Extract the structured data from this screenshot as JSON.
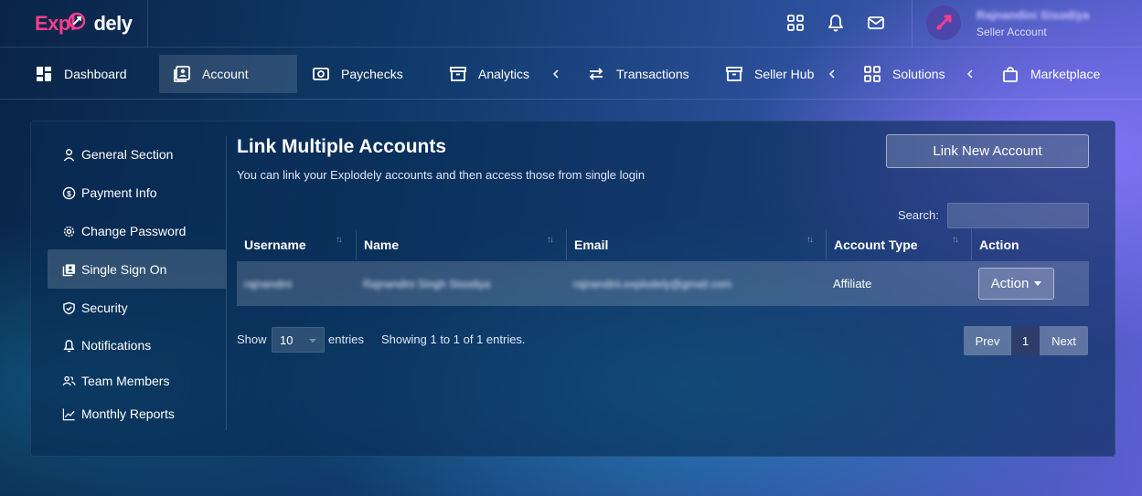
{
  "app": {
    "logo_prefix": "Expl",
    "logo_suffix": "dely",
    "logo_mark": "rocket-icon"
  },
  "header": {
    "icons": [
      "apps-grid-icon",
      "bell-icon",
      "mail-icon"
    ],
    "user": {
      "name": "Rajnandini Sisodiya",
      "role": "Seller Account",
      "avatar_icon": "rocket-icon"
    }
  },
  "nav": {
    "items": [
      {
        "label": "Dashboard",
        "icon": "dashboard-icon",
        "active": false
      },
      {
        "label": "Account",
        "icon": "account-icon",
        "active": true
      },
      {
        "label": "Paychecks",
        "icon": "paycheck-icon",
        "active": false
      },
      {
        "label": "Analytics",
        "icon": "archive-icon",
        "active": false
      },
      {
        "label": "Transactions",
        "icon": "transfer-icon",
        "active": false
      },
      {
        "label": "Seller Hub",
        "icon": "archive-icon",
        "active": false
      },
      {
        "label": "Solutions",
        "icon": "grid-icon",
        "active": false
      },
      {
        "label": "Marketplace",
        "icon": "bag-icon",
        "active": false
      }
    ]
  },
  "sidebar": {
    "items": [
      {
        "label": "General Section",
        "icon": "user-icon"
      },
      {
        "label": "Payment Info",
        "icon": "dollar-icon"
      },
      {
        "label": "Change Password",
        "icon": "gear-icon"
      },
      {
        "label": "Single Sign On",
        "icon": "account-icon",
        "active": true
      },
      {
        "label": "Security",
        "icon": "shield-icon"
      },
      {
        "label": "Notifications",
        "icon": "bell-icon"
      },
      {
        "label": "Team Members",
        "icon": "team-icon"
      },
      {
        "label": "Monthly Reports",
        "icon": "chart-icon"
      }
    ]
  },
  "main": {
    "title": "Link Multiple Accounts",
    "subtitle": "You can link your Explodely accounts and then access those from single login",
    "link_button": "Link New Account",
    "search_label": "Search:",
    "search_value": "",
    "columns": [
      "Username",
      "Name",
      "Email",
      "Account Type",
      "Action"
    ],
    "rows": [
      {
        "username": "rajnandini",
        "name": "Rajnandini Singh Sisodiya",
        "email": "rajnandini.explodely@gmail.com",
        "account_type": "Affiliate",
        "action": "Action"
      }
    ],
    "show_label": "Show",
    "page_size": "10",
    "entries_label": "entries",
    "showing_text": "Showing 1 to 1 of 1 entries.",
    "pagination": {
      "prev": "Prev",
      "current": "1",
      "next": "Next"
    }
  },
  "colors": {
    "brand_pink": "#ff3d8b",
    "accent_purple": "#6a5cff",
    "pager_active": "#2c3d6a"
  }
}
